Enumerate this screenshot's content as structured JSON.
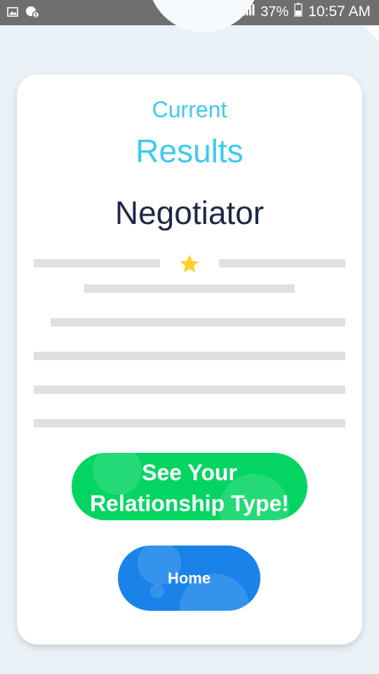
{
  "status_bar": {
    "battery": "37%",
    "time": "10:57 AM",
    "icons": [
      "image-icon",
      "notification-icon",
      "wifi-icon",
      "signal-icon",
      "battery-icon"
    ]
  },
  "card": {
    "current_label": "Current",
    "results_label": "Results",
    "result_type": "Negotiator",
    "star_icon": "star-icon",
    "star_color": "#fcd02f"
  },
  "buttons": {
    "relationship_type": "See Your Relationship Type!",
    "home": "Home"
  },
  "colors": {
    "accent_cyan": "#3ccaf2",
    "title_dark": "#1f2744",
    "button_green": "#04d562",
    "button_blue": "#1983ea",
    "status_bar": "#6f6f6f"
  }
}
